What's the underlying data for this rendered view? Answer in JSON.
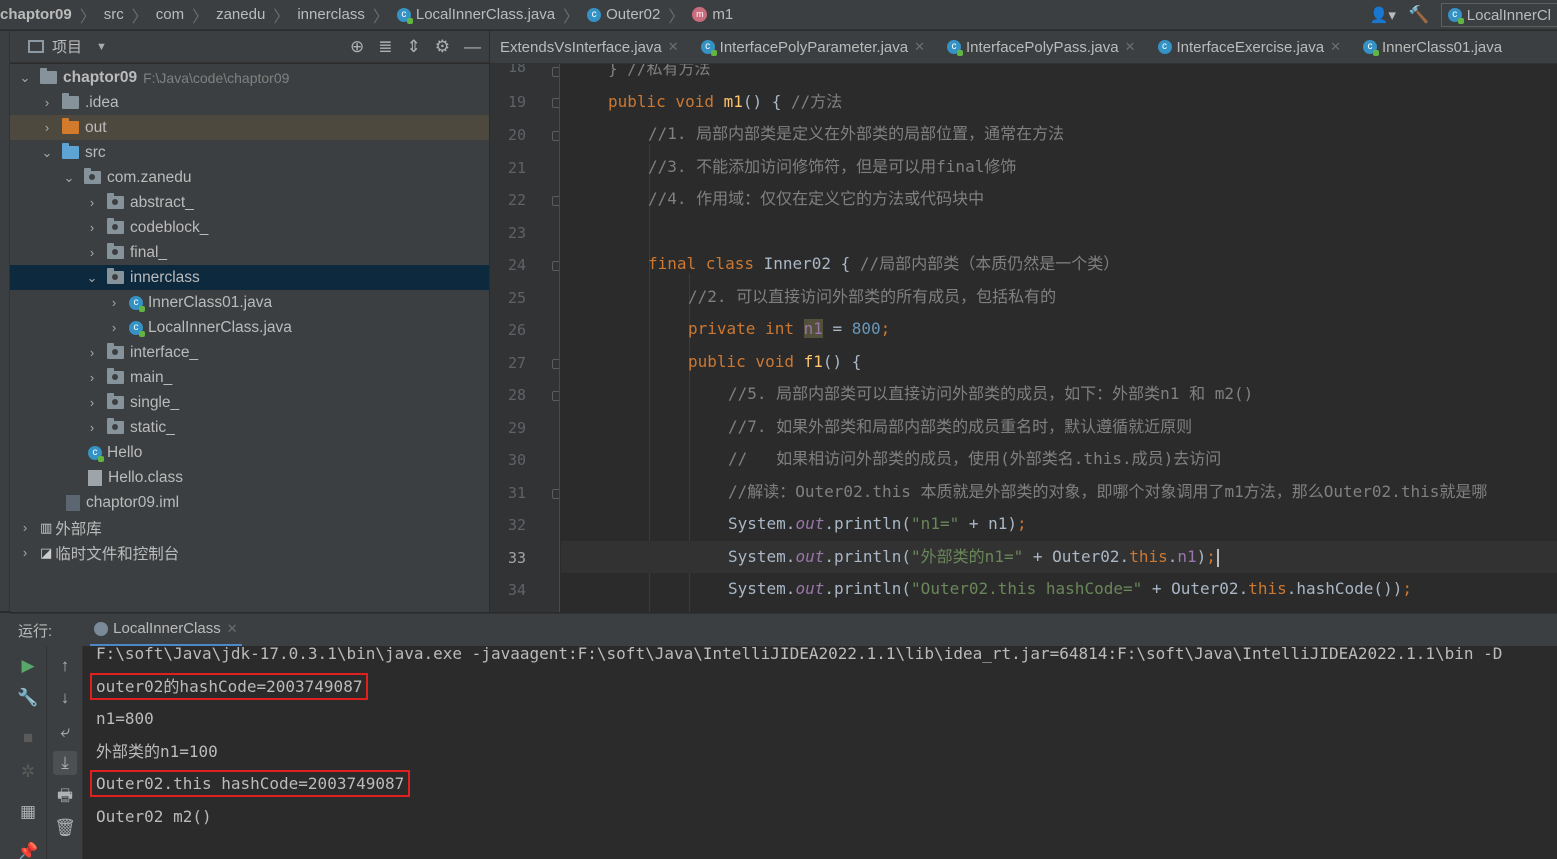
{
  "breadcrumb": {
    "project": "chaptor09",
    "src": "src",
    "pkg1": "com",
    "pkg2": "zanedu",
    "pkg3": "innerclass",
    "file": "LocalInnerClass.java",
    "class": "Outer02",
    "method": "m1",
    "run_config": "LocalInnerCl"
  },
  "project_panel": {
    "title": "项目",
    "tree": [
      {
        "label": "chaptor09",
        "path": "F:\\Java\\code\\chaptor09"
      },
      {
        "label": ".idea"
      },
      {
        "label": "out"
      },
      {
        "label": "src"
      },
      {
        "label": "com.zanedu"
      },
      {
        "label": "abstract_"
      },
      {
        "label": "codeblock_"
      },
      {
        "label": "final_"
      },
      {
        "label": "innerclass"
      },
      {
        "label": "InnerClass01.java"
      },
      {
        "label": "LocalInnerClass.java"
      },
      {
        "label": "interface_"
      },
      {
        "label": "main_"
      },
      {
        "label": "single_"
      },
      {
        "label": "static_"
      },
      {
        "label": "Hello"
      },
      {
        "label": "Hello.class"
      },
      {
        "label": "chaptor09.iml"
      },
      {
        "label": "外部库"
      },
      {
        "label": "临时文件和控制台"
      }
    ]
  },
  "editor_tabs": [
    "ExtendsVsInterface.java",
    "InterfacePolyParameter.java",
    "InterfacePolyPass.java",
    "InterfaceExercise.java",
    "InnerClass01.java"
  ],
  "code": {
    "line_numbers": [
      "18",
      "19",
      "20",
      "21",
      "22",
      "23",
      "24",
      "25",
      "26",
      "27",
      "28",
      "29",
      "30",
      "31",
      "32",
      "33",
      "34"
    ],
    "l18": "} //私有方法",
    "l19_kw": "public void ",
    "l19_fn": "m1",
    "l19_rest": "() { ",
    "l19_cm": "//方法",
    "l20": "//1. 局部内部类是定义在外部类的局部位置，通常在方法",
    "l21": "//3. 不能添加访问修饰符，但是可以用final修饰",
    "l22": "//4. 作用域：仅仅在定义它的方法或代码块中",
    "l24_kw": "final class ",
    "l24_name": "Inner02 { ",
    "l24_cm": "//局部内部类（本质仍然是一个类）",
    "l25": "//2. 可以直接访问外部类的所有成员，包括私有的",
    "l26_kw": "private int ",
    "l26_var": "n1",
    "l26_eq": " = ",
    "l26_num": "800",
    "l26_semi": ";",
    "l27_kw": "public void ",
    "l27_fn": "f1",
    "l27_rest": "() {",
    "l28": "//5. 局部内部类可以直接访问外部类的成员，如下：外部类n1 和 m2()",
    "l29": "//7. 如果外部类和局部内部类的成员重名时，默认遵循就近原则",
    "l30": "//   如果相访问外部类的成员，使用(外部类名.this.成员)去访问",
    "l31": "//解读：Outer02.this 本质就是外部类的对象，即哪个对象调用了m1方法，那么Outer02.this就是哪",
    "l32_a": "System.",
    "l32_out": "out",
    "l32_b": ".println(",
    "l32_str": "\"n1=\"",
    "l32_c": " + n1)",
    "l32_semi": ";",
    "l33_a": "System.",
    "l33_out": "out",
    "l33_b": ".println(",
    "l33_str": "\"外部类的n1=\"",
    "l33_c": " + Outer02.",
    "l33_this": "this",
    "l33_d": ".",
    "l33_n1": "n1",
    "l33_e": ")",
    "l33_semi": ";",
    "l34_a": "System.",
    "l34_out": "out",
    "l34_b": ".println(",
    "l34_str": "\"Outer02.this hashCode=\"",
    "l34_c": " + Outer02.",
    "l34_this": "this",
    "l34_d": ".hashCode())",
    "l34_semi": ";"
  },
  "run_panel": {
    "label": "运行:",
    "tab": "LocalInnerClass"
  },
  "console": {
    "lines": [
      "F:\\soft\\Java\\jdk-17.0.3.1\\bin\\java.exe -javaagent:F:\\soft\\Java\\IntelliJIDEA2022.1.1\\lib\\idea_rt.jar=64814:F:\\soft\\Java\\IntelliJIDEA2022.1.1\\bin -D",
      "outer02的hashCode=2003749087",
      "n1=800",
      "外部类的n1=100",
      "Outer02.this hashCode=2003749087",
      "Outer02 m2()"
    ]
  },
  "colors": {
    "keyword": "#cc7832",
    "comment": "#808080",
    "string": "#6a8759",
    "number": "#6897bb",
    "field": "#9876aa",
    "function": "#ffc66d",
    "highlight_box": "#e0201e"
  }
}
